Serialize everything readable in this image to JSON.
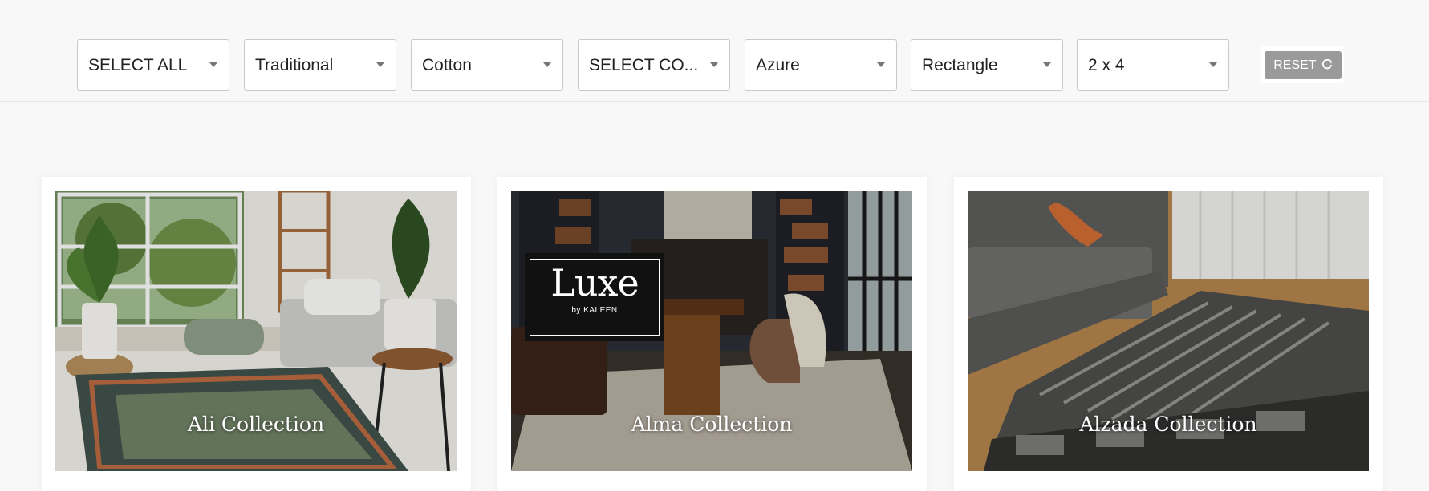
{
  "filters": [
    {
      "value": "SELECT ALL"
    },
    {
      "value": "Traditional"
    },
    {
      "value": "Cotton"
    },
    {
      "value": "SELECT CO..."
    },
    {
      "value": "Azure"
    },
    {
      "value": "Rectangle"
    },
    {
      "value": "2 x 4"
    }
  ],
  "reset": {
    "label": "RESET",
    "icon": "refresh-icon"
  },
  "collections": [
    {
      "title": "Ali Collection"
    },
    {
      "title": "Alma Collection",
      "logo": {
        "word": "Luxe",
        "byline": "by KALEEN"
      }
    },
    {
      "title": "Alzada Collection"
    }
  ]
}
